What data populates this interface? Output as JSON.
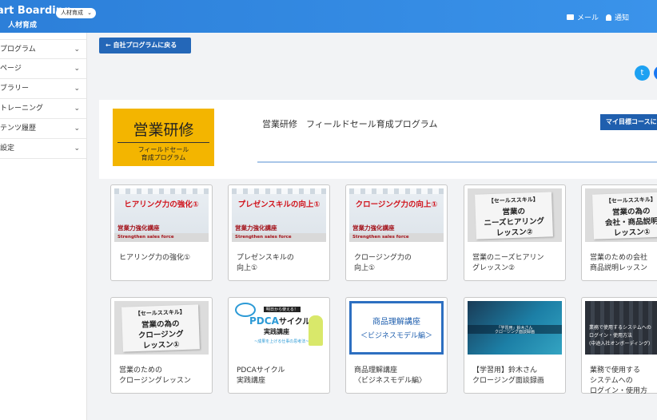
{
  "header": {
    "brand": "art Boarding",
    "brand_sub": "人材育成",
    "org_select": "人材育成",
    "mail_label": "メール",
    "notify_label": "通知"
  },
  "sidebar": {
    "items": [
      {
        "label": "プログラム"
      },
      {
        "label": "ページ"
      },
      {
        "label": "ブラリー"
      },
      {
        "label": "トレーニング"
      },
      {
        "label": "テンツ履歴"
      },
      {
        "label": "設定"
      }
    ]
  },
  "back_button": "自社プログラムに戻る",
  "hero": {
    "thumb_title": "営業研修",
    "thumb_sub1": "フィールドセール",
    "thumb_sub2": "育成プログラム",
    "program_name": "営業研修　フィールドセール育成プログラム",
    "my_goal_button": "マイ目標コースに"
  },
  "cards": [
    {
      "thumb_top": "ヒアリング力の強化①",
      "thumb_mid": "営業力強化講座",
      "thumb_bot": "Strengthen sales force",
      "title_l1": "ヒアリング力の強化①",
      "title_l2": ""
    },
    {
      "thumb_top": "プレゼンスキルの向上①",
      "thumb_mid": "営業力強化講座",
      "thumb_bot": "Strengthen sales force",
      "title_l1": "プレゼンスキルの",
      "title_l2": "向上①"
    },
    {
      "thumb_top": "クロージング力の向上①",
      "thumb_mid": "営業力強化講座",
      "thumb_bot": "Strengthen sales force",
      "title_l1": "クロージング力の",
      "title_l2": "向上①"
    },
    {
      "thumb_cap": "【セールススキル】",
      "thumb_big": "営業の\nニーズヒアリング\nレッスン②",
      "title_l1": "営業のニーズヒアリン",
      "title_l2": "グレッスン②"
    },
    {
      "thumb_cap": "【セールススキル】",
      "thumb_big": "営業の為の\n会社・商品説明\nレッスン①",
      "title_l1": "営業のための会社",
      "title_l2": "商品説明レッスン"
    },
    {
      "thumb_cap": "【セールススキル】",
      "thumb_big": "営業の為の\nクロージング\nレッスン①",
      "title_l1": "営業のための",
      "title_l2": "クロージングレッスン"
    },
    {
      "thumb_ptop": "明日から使える！",
      "thumb_pdca": "PDCA",
      "thumb_pdca2": "サイクル",
      "thumb_jissen": "実践講座",
      "thumb_sub": "~成果を上げる仕事の思考法~",
      "title_l1": "PDCAサイクル",
      "title_l2": "実践講座"
    },
    {
      "thumb_l1": "商品理解講座",
      "thumb_l2": "＜ビジネスモデル編＞",
      "title_l1": "商品理解講座",
      "title_l2": "〈ビジネスモデル編〉"
    },
    {
      "thumb_t1": "「学習用」鈴木さん",
      "thumb_t2": "クロージング面談録画",
      "title_l1": "【学習用】鈴木さん",
      "title_l2": "クロージング面談録画"
    },
    {
      "thumb_t1": "業務で使用するシステムへの",
      "thumb_t2": "ログイン・使用方法",
      "thumb_t3": "(中途入社オンボーディング)",
      "title_l1": "業務で使用する",
      "title_l2": "システムへの",
      "title_l3": "ログイン・使用方"
    }
  ]
}
